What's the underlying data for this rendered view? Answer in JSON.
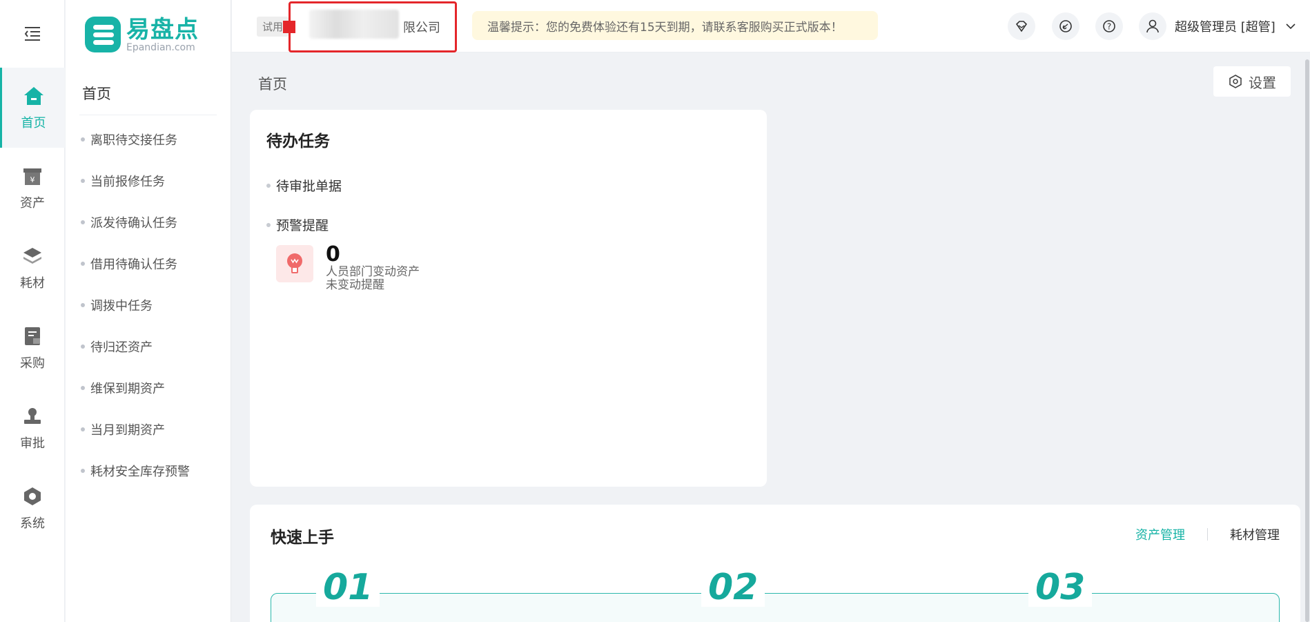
{
  "rail": {
    "items": [
      {
        "label": "首页",
        "icon": "home-icon",
        "active": true
      },
      {
        "label": "资产",
        "icon": "asset-box-icon"
      },
      {
        "label": "耗材",
        "icon": "layers-icon"
      },
      {
        "label": "采购",
        "icon": "purchase-doc-icon"
      },
      {
        "label": "审批",
        "icon": "approval-stamp-icon"
      },
      {
        "label": "系统",
        "icon": "hexagon-settings-icon"
      }
    ]
  },
  "logo": {
    "cn": "易盘点",
    "en": "Epandian.com"
  },
  "submenu": {
    "title": "首页",
    "items": [
      "离职待交接任务",
      "当前报修任务",
      "派发待确认任务",
      "借用待确认任务",
      "调拨中任务",
      "待归还资产",
      "维保到期资产",
      "当月到期资产",
      "耗材安全库存预警"
    ]
  },
  "header": {
    "trial": "试用",
    "company_suffix": "限公司",
    "notice": "温馨提示：您的免费体验还有15天到期，请联系客服购买正式版本！",
    "user": "超级管理员 [超管]"
  },
  "breadcrumb": "首页",
  "settings_label": "设置",
  "todo": {
    "title": "待办任务",
    "section_pending": "待审批单据",
    "section_alert": "预警提醒",
    "alert": {
      "count": "0",
      "line1": "人员部门变动资产",
      "line2": "未变动提醒"
    }
  },
  "quick": {
    "title": "快速上手",
    "tab_asset": "资产管理",
    "tab_consumable": "耗材管理",
    "steps": [
      "01",
      "02",
      "03"
    ]
  },
  "colors": {
    "accent": "#16b3a6",
    "alert_red": "#e4262a",
    "notice_bg": "#fff8df"
  }
}
